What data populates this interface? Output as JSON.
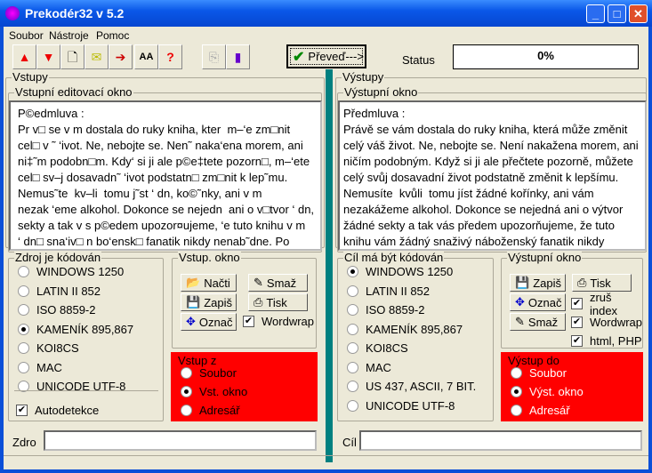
{
  "window": {
    "title": "Prekodér32 v 5.2",
    "controls": [
      "_",
      "□",
      "✕"
    ]
  },
  "menu": [
    "Soubor",
    "Nástroje",
    "Pomoc"
  ],
  "toolbar": {
    "icons": [
      "arrow-up-icon",
      "arrow-down-icon",
      "new-file-icon",
      "mail-icon",
      "paste-icon",
      "font-case-icon",
      "help-icon",
      "copy-disabled-icon",
      "exit-icon"
    ],
    "convert_label": "Převeď--->",
    "status_label": "Status",
    "progress": "0%"
  },
  "left": {
    "title": "Vstupy",
    "editor_title": "Vstupní editovací okno",
    "text": "P©edmluva :\nPr v□ se v m dostala do ruky kniha, kter  m–‘e zm□nit\ncel□ v ˜ ‘ivot. Ne, nebojte se. Nen˜ naka‘ena morem, ani\nni‡˜m podobn□m. Kdy‘ si ji ale p©e‡tete pozorn□, m–‘ete\ncel□ sv–j dosavadn˜ ‘ivot podstatn□ zm□nit k lep˜mu.\nNemus˜te  kv–li  tomu j˜st ‘ dn, ko©˜nky, ani v m\nnezak ‘eme alkohol. Dokonce se nejedn  ani o v□tvor ‘ dn,\nsekty a tak v s p©edem upozor¤ujeme, ‘e tuto knihu v m\n‘ dn□ sna‘iv□ n bo‘ensk□ fanatik nikdy nenab˜dne. Po\nnej˜m p©e‡ten˜ by toti‘ ji‘ nikdy knihy trapn□ nerozd val, ale",
    "encoding_title": "Zdroj je kódován",
    "encodings": [
      "WINDOWS 1250",
      "LATIN II 852",
      "ISO 8859-2",
      "KAMENÍK 895,867",
      "KOI8CS",
      "MAC",
      "UNICODE UTF-8"
    ],
    "selected": 3,
    "autodetect": "Autodetekce",
    "window_group": "Vstup. okno",
    "buttons": [
      "Načti",
      "Smaž",
      "Zapiš",
      "Tisk",
      "Označ"
    ],
    "wordwrap": "Wordwrap",
    "source_title": "Vstup z",
    "sources": [
      "Soubor",
      "Vst. okno",
      "Adresář"
    ],
    "source_selected": 1,
    "path_label": "Zdro"
  },
  "right": {
    "title": "Výstupy",
    "editor_title": "Výstupní okno",
    "text": "Předmluva :\nPrávě se vám dostala do ruky kniha, která může změnit\ncelý váš život. Ne, nebojte se. Není nakažena morem, ani\nničím podobným. Když si ji ale přečtete pozorně, můžete\ncelý svůj dosavadní život podstatně změnit k lepšímu.\nNemusíte  kvůli  tomu jíst žádné kořínky, ani vám\nnezakážeme alkohol. Dokonce se nejedná ani o výtvor\nžádné sekty a tak vás předem upozorňujeme, že tuto\nknihu vám žádný snaživý náboženský fanatik nikdy\nnenabídne. Po jejím přečtení by totiž již nikdy knihy",
    "encoding_title": "Cíl má být kódován",
    "encodings": [
      "WINDOWS 1250",
      "LATIN II 852",
      "ISO 8859-2",
      "KAMENÍK 895,867",
      "KOI8CS",
      "MAC",
      "US 437, ASCII, 7 BIT.",
      "UNICODE UTF-8"
    ],
    "selected": 0,
    "window_group": "Výstupní okno",
    "buttons": [
      "Zapiš",
      "Tisk",
      "Označ",
      "Smaž"
    ],
    "checks": [
      "zruš index",
      "Wordwrap",
      "html, PHP"
    ],
    "dest_title": "Výstup do",
    "dests": [
      "Soubor",
      "Výst. okno",
      "Adresář"
    ],
    "dest_selected": 1,
    "path_label": "Cíl"
  },
  "colors": {
    "accent": "#ff0000",
    "divider": "#008080"
  }
}
